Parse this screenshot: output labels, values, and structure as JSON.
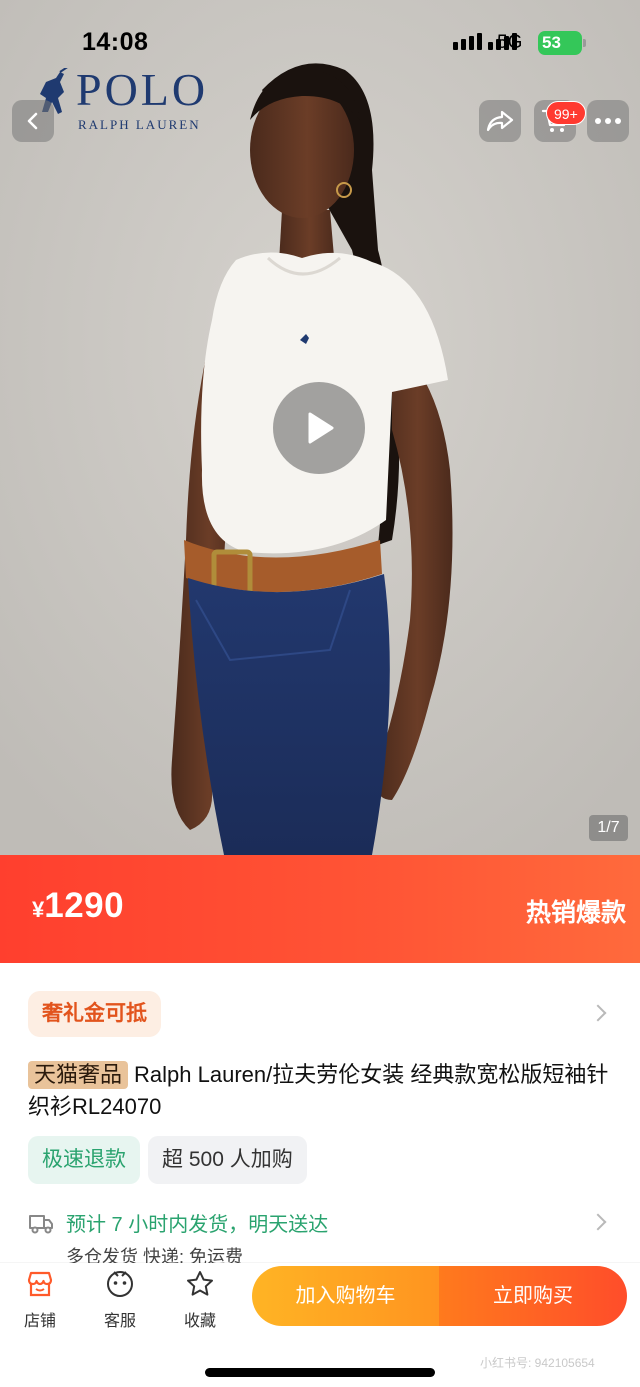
{
  "status_bar": {
    "time": "14:08",
    "network": "5G",
    "battery": "53"
  },
  "brand": {
    "name": "POLO",
    "sub": "RALPH LAUREN"
  },
  "header": {
    "cart_badge": "99+"
  },
  "media": {
    "page_indicator": "1/7"
  },
  "price_banner": {
    "currency": "¥",
    "price": "1290",
    "tag": "热销爆款"
  },
  "info": {
    "coupon": "奢礼金可抵",
    "title_tag": "天猫奢品",
    "title": "Ralph Lauren/拉夫劳伦女装 经典款宽松版短袖针织衫RL24070",
    "tags": [
      "极速退款",
      "超 500 人加购"
    ],
    "delivery": "预计 7 小时内发货，明天送达",
    "shipping_sub": "多仓发货 快递: 免运费"
  },
  "bottom_nav": {
    "items": [
      {
        "label": "店铺",
        "icon": "store-icon"
      },
      {
        "label": "客服",
        "icon": "customer-service-icon"
      },
      {
        "label": "收藏",
        "icon": "star-icon"
      }
    ],
    "add_to_cart": "加入购物车",
    "buy_now": "立即购买"
  },
  "watermark": "小红书号: 942105654",
  "colors": {
    "accent": "#ff4a30",
    "cart_cta": "#ffa420",
    "green": "#2aa36f"
  }
}
